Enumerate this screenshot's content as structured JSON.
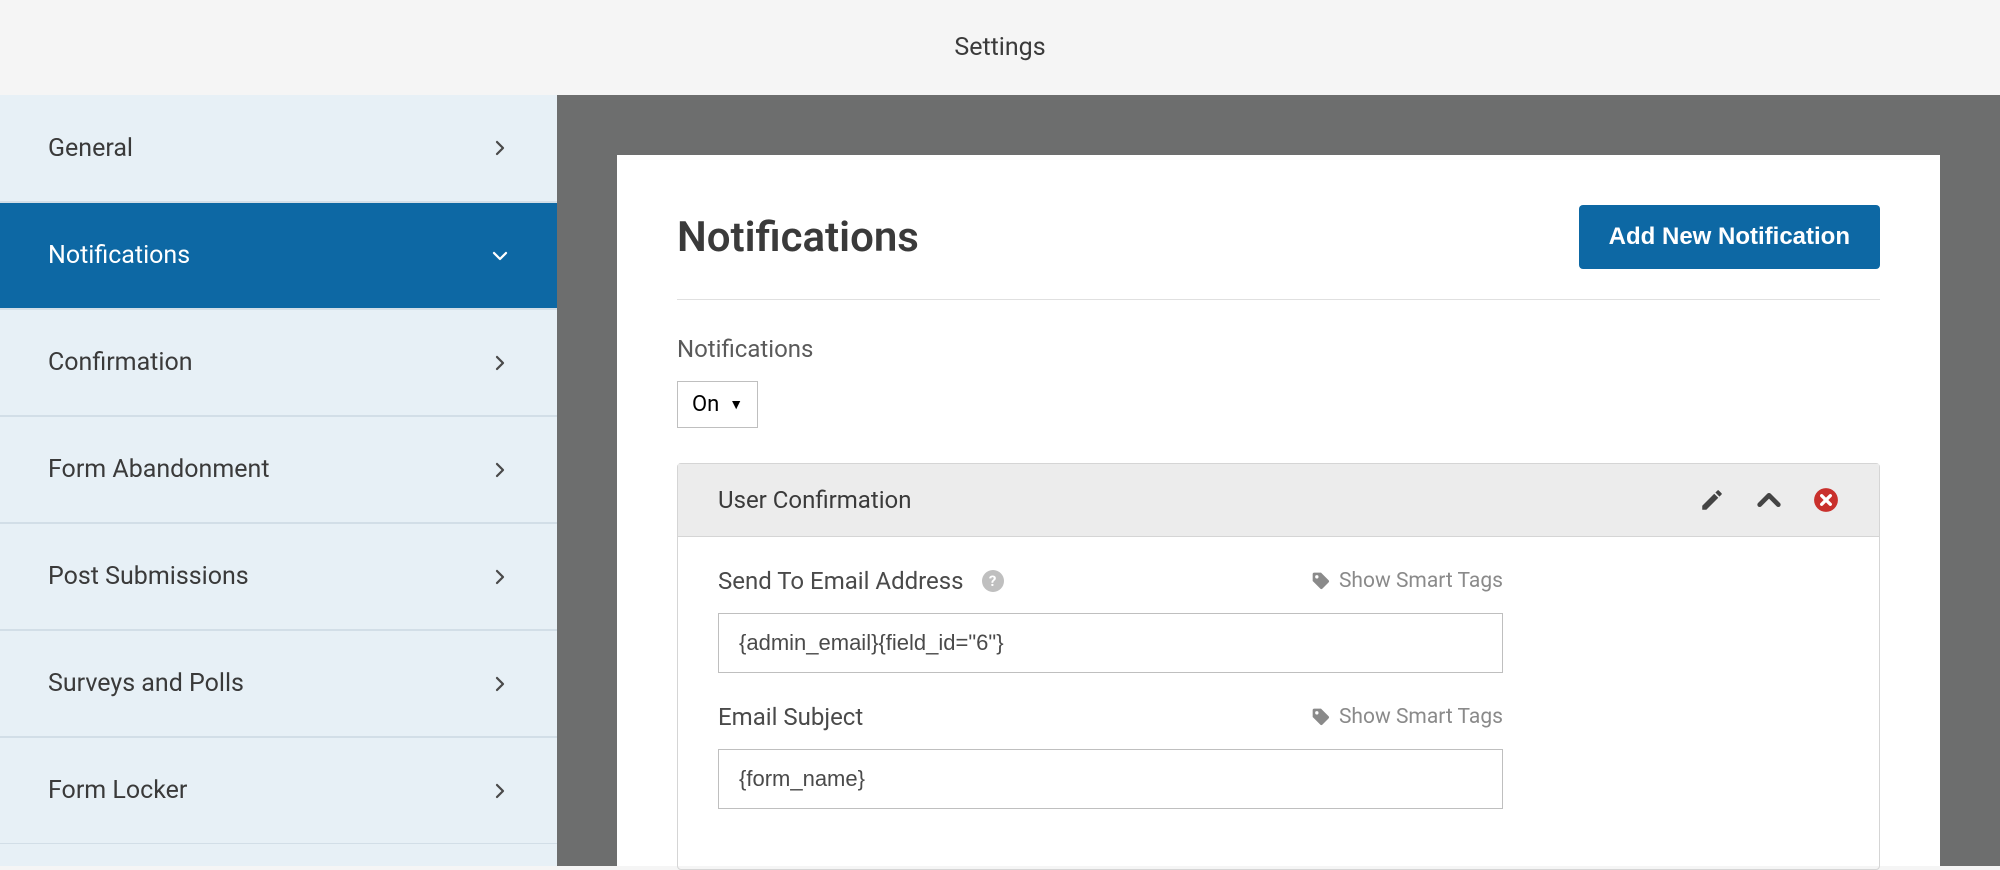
{
  "header": {
    "title": "Settings"
  },
  "sidebar": {
    "items": [
      {
        "label": "General"
      },
      {
        "label": "Notifications"
      },
      {
        "label": "Confirmation"
      },
      {
        "label": "Form Abandonment"
      },
      {
        "label": "Post Submissions"
      },
      {
        "label": "Surveys and Polls"
      },
      {
        "label": "Form Locker"
      }
    ]
  },
  "panel": {
    "title": "Notifications",
    "add_button": "Add New Notification",
    "toggle_label": "Notifications",
    "toggle_value": "On",
    "notification": {
      "title": "User Confirmation",
      "fields": {
        "send_to": {
          "label": "Send To Email Address",
          "value": "{admin_email}{field_id=\"6\"}",
          "smart_tags": "Show Smart Tags"
        },
        "subject": {
          "label": "Email Subject",
          "value": "{form_name}",
          "smart_tags": "Show Smart Tags"
        }
      }
    }
  }
}
